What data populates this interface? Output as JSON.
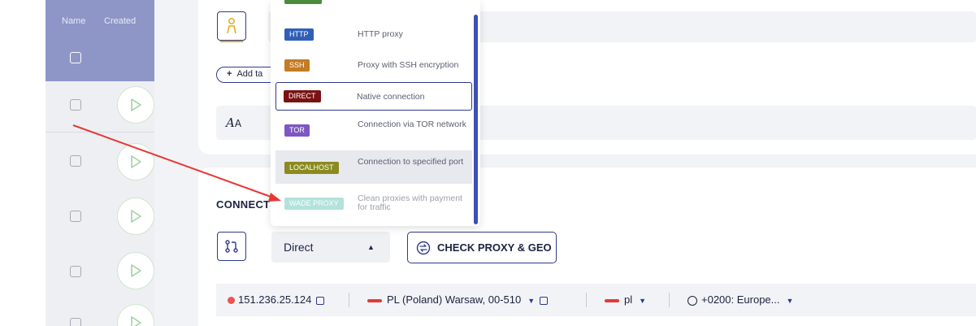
{
  "table": {
    "columns": [
      "Name",
      "Created"
    ]
  },
  "tags": {
    "add_label": "Add ta"
  },
  "connection": {
    "title": "CONNECT",
    "proxy_type_value": "Direct",
    "check_button_label": "CHECK PROXY & GEO"
  },
  "proxy_menu": {
    "options": [
      {
        "badge": "HTTP",
        "description": "HTTP proxy",
        "color": "#2f5fb8"
      },
      {
        "badge": "SSH",
        "description": "Proxy with SSH encryption",
        "color": "#c47b24"
      },
      {
        "badge": "DIRECT",
        "description": "Native connection",
        "color": "#7a1212",
        "selected": true
      },
      {
        "badge": "TOR",
        "description": "Connection via TOR network",
        "color": "#7e57c2"
      },
      {
        "badge": "LOCALHOST",
        "description": "Connection to specified port",
        "color": "#8b8a1e"
      },
      {
        "badge": "WADE PROXY",
        "description": "Clean proxies with payment for traffic",
        "color": "#7fd0c4"
      }
    ]
  },
  "info_bar": {
    "ip": "151.236.25.124",
    "location": "PL (Poland) Warsaw, 00-510",
    "language": "pl",
    "timezone": "+0200: Europe..."
  },
  "colors": {
    "accent": "#2d3a8c",
    "header": "#8e96c7",
    "arrow": "#e53935",
    "status_dot": "#ef5350"
  }
}
